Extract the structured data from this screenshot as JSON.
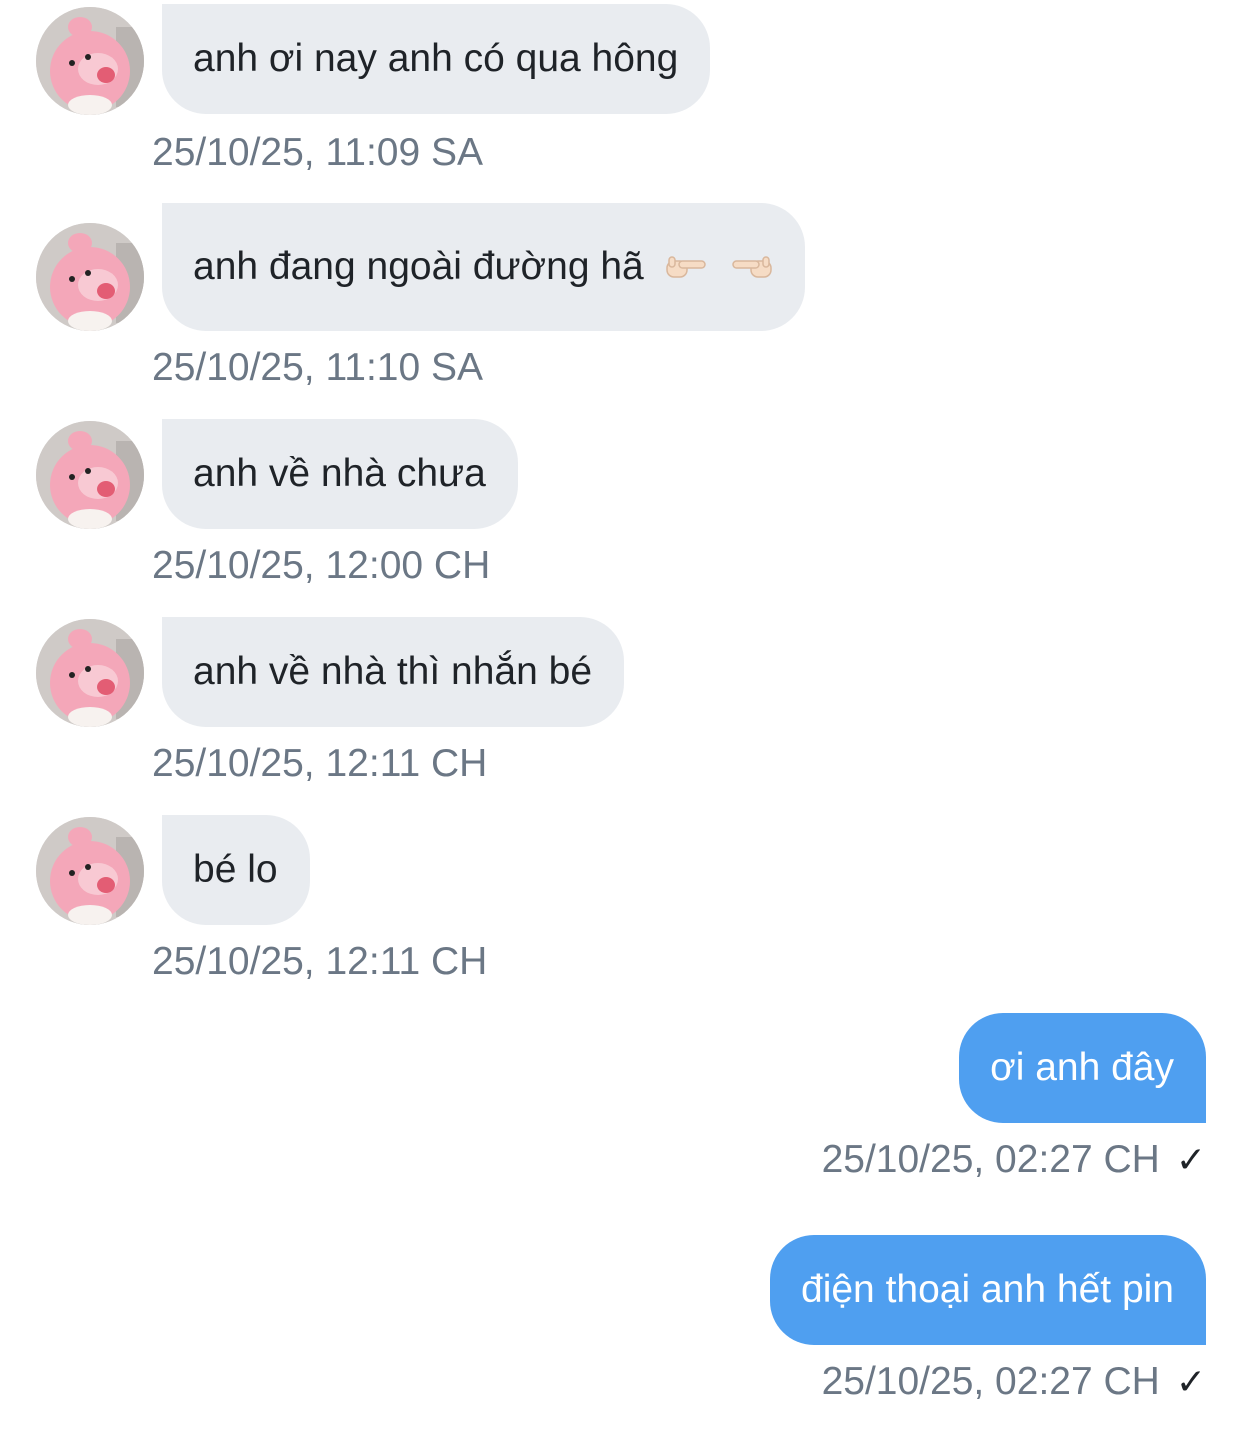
{
  "messages": [
    {
      "direction": "incoming",
      "text": "anh ơi nay anh có qua hông",
      "timestamp": "25/10/25, 11:09 SA"
    },
    {
      "direction": "incoming",
      "text": "anh đang ngoài đường hã",
      "emoji": [
        "backhand-index-pointing-right",
        "backhand-index-pointing-left"
      ],
      "timestamp": "25/10/25, 11:10 SA"
    },
    {
      "direction": "incoming",
      "text": "anh về nhà chưa",
      "timestamp": "25/10/25, 12:00 CH"
    },
    {
      "direction": "incoming",
      "text": "anh về nhà thì nhắn bé",
      "timestamp": "25/10/25, 12:11 CH"
    },
    {
      "direction": "incoming",
      "text": "bé lo",
      "timestamp": "25/10/25, 12:11 CH"
    },
    {
      "direction": "outgoing",
      "text": "ơi anh đây",
      "timestamp": "25/10/25, 02:27 CH",
      "status": "✓"
    },
    {
      "direction": "outgoing",
      "text": "điện thoại anh hết pin",
      "timestamp": "25/10/25, 02:27 CH",
      "status": "✓"
    }
  ],
  "colors": {
    "incoming_bubble": "#e9ecf0",
    "outgoing_bubble": "#4f9ff0",
    "timestamp": "#6b7785",
    "avatar_pink": "#f4a7b9"
  },
  "icons": {
    "avatar": "pink-bear-avatar",
    "sent_status": "checkmark-icon"
  }
}
